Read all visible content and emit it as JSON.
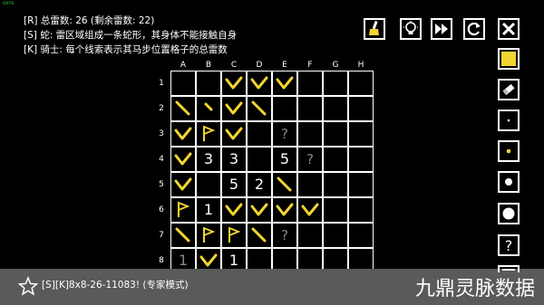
{
  "fps_text": "60FPS",
  "rules": {
    "line1": "[R] 总雷数: 26 (剩余雷数: 22)",
    "line2": "[S] 蛇: 雷区域组成一条蛇形，其身体不能接触自身",
    "line3": "[K] 骑士: 每个线索表示其马步位置格子的总雷数"
  },
  "toolbar": [
    {
      "name": "hint-brush-button",
      "icon": "brush-icon"
    },
    {
      "name": "lightbulb-button",
      "icon": "lightbulb-icon"
    },
    {
      "name": "skip-button",
      "icon": "fast-forward-icon"
    },
    {
      "name": "restart-button",
      "icon": "restart-icon"
    },
    {
      "name": "close-button",
      "icon": "close-icon"
    }
  ],
  "tools": [
    {
      "name": "fill-yellow-tool",
      "icon": "yellow-square-icon"
    },
    {
      "name": "eraser-tool",
      "icon": "eraser-icon"
    },
    {
      "name": "dot-small-tool",
      "icon": "small-dot-icon"
    },
    {
      "name": "dot-yellow-tool",
      "icon": "yellow-dot-icon"
    },
    {
      "name": "dot-medium-tool",
      "icon": "medium-dot-icon"
    },
    {
      "name": "dot-large-tool",
      "icon": "large-dot-icon"
    },
    {
      "name": "question-tool",
      "icon": "question-mark-icon",
      "label": "?"
    },
    {
      "name": "menu-tool",
      "icon": "menu-icon"
    }
  ],
  "columns": [
    "A",
    "B",
    "C",
    "D",
    "E",
    "F",
    "G",
    "H"
  ],
  "rows": [
    "1",
    "2",
    "3",
    "4",
    "5",
    "6",
    "7",
    "8"
  ],
  "board": [
    [
      "",
      "",
      "V",
      "V",
      "V",
      "",
      "",
      ""
    ],
    [
      "\\",
      "'",
      "V",
      "\\",
      "",
      "",
      "",
      ""
    ],
    [
      "V",
      "F",
      "V",
      "",
      "?",
      "",
      "",
      ""
    ],
    [
      "V",
      "3",
      "3",
      "",
      "5",
      "?",
      "",
      ""
    ],
    [
      "V",
      "",
      "5",
      "2",
      "\\",
      "",
      "",
      ""
    ],
    [
      "F",
      "1",
      "V",
      "V",
      "V",
      "V",
      "",
      ""
    ],
    [
      "\\",
      "F",
      "F",
      "\\",
      "?",
      "",
      "",
      ""
    ],
    [
      "1d",
      "V",
      "1",
      "",
      "",
      "",
      "",
      ""
    ]
  ],
  "colors": {
    "mark": "#f2d531",
    "flag": "#f2d531",
    "background": "#000000",
    "bar": "#5a5a5a"
  },
  "status": {
    "text": "[S][K]8x8-26-11083! (专家模式)"
  },
  "watermark": "九鼎灵脉数据"
}
